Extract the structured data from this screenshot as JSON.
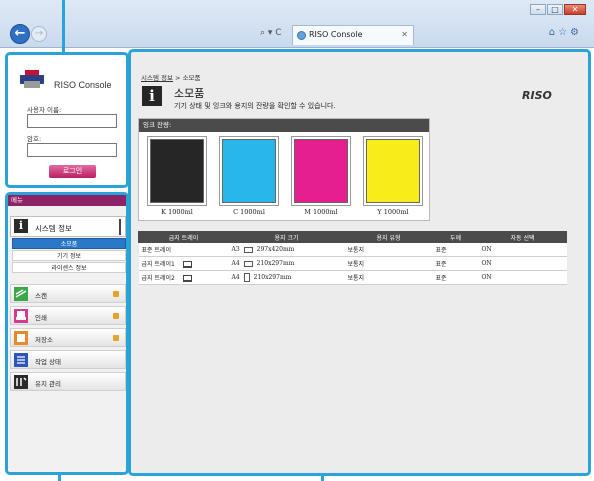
{
  "browser": {
    "tab_title": "RISO Console",
    "addr_tools": "⌕ ▾ C"
  },
  "login": {
    "app_name": "RISO Console",
    "username_label": "사용자 이름:",
    "password_label": "암호:",
    "username_value": "",
    "password_value": "",
    "login_button": "로그인"
  },
  "menu": {
    "header": "메뉴",
    "system_info": "시스템 정보",
    "sub_items": [
      "소모품",
      "기기 정보",
      "라이센스 정보"
    ],
    "items": [
      {
        "label": "스캔",
        "icon": "scan-icon",
        "locked": true
      },
      {
        "label": "인쇄",
        "icon": "print-icon",
        "locked": true
      },
      {
        "label": "저장소",
        "icon": "storage-icon",
        "locked": true
      },
      {
        "label": "작업 상태",
        "icon": "job-status-icon",
        "locked": false
      },
      {
        "label": "유지 관리",
        "icon": "maintenance-icon",
        "locked": false
      }
    ]
  },
  "main": {
    "breadcrumb_link": "시스템 정보",
    "breadcrumb_sep": " > ",
    "breadcrumb_current": "소모품",
    "title": "소모품",
    "description": "기기 상태 및 잉크와 용지의 잔량을 확인할 수 있습니다.",
    "brand": "RISO"
  },
  "ink": {
    "header": "잉크 잔량:",
    "cartridges": [
      {
        "label": "K 1000ml",
        "color": "#262626"
      },
      {
        "label": "C 1000ml",
        "color": "#29b6e8"
      },
      {
        "label": "M 1000ml",
        "color": "#e51f8f"
      },
      {
        "label": "Y 1000ml",
        "color": "#f8ec1a"
      }
    ]
  },
  "trays": {
    "headers": [
      "급지 트레이",
      "용지 크기",
      "용지 유형",
      "두께",
      "자동 선택"
    ],
    "rows": [
      {
        "tray": "표준 트레이",
        "size_code": "A3",
        "size_mm": "297x420mm",
        "type": "보통지",
        "thickness": "표준",
        "auto": "ON"
      },
      {
        "tray": "급지 트레이1",
        "size_code": "A4",
        "size_mm": "210x297mm",
        "type": "보통지",
        "thickness": "표준",
        "auto": "ON"
      },
      {
        "tray": "급지 트레이2",
        "size_code": "A4",
        "size_mm": "210x297mm",
        "type": "보통지",
        "thickness": "표준",
        "auto": "ON"
      }
    ]
  }
}
